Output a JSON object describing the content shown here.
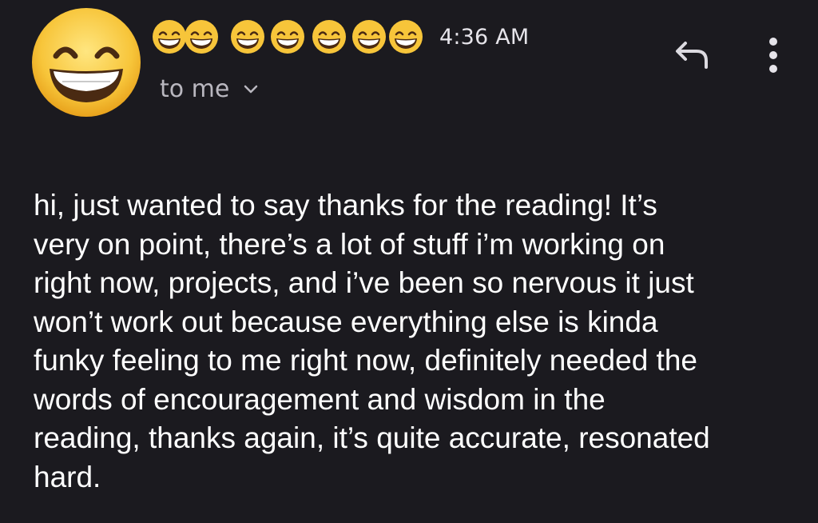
{
  "header": {
    "sender_avatar_icon": "grinning-face-with-smiling-eyes",
    "sender_name_icons": [
      "grinning-face-with-smiling-eyes",
      "grinning-face-with-smiling-eyes",
      "grinning-face-with-smiling-eyes",
      "grinning-face-with-smiling-eyes",
      "grinning-face-with-smiling-eyes",
      "grinning-face-with-smiling-eyes",
      "grinning-face-with-smiling-eyes"
    ],
    "time": "4:36 AM",
    "recipient_label": "to me",
    "recipient_icon": "chevron-down-icon",
    "reply_icon": "reply-icon",
    "more_icon": "more-vert-icon"
  },
  "message": {
    "body": "hi, just wanted to say thanks for the reading! It’s\nvery on point, there’s a lot of stuff i’m working on\nright now, projects, and i’ve been so nervous it just\nwon’t work out because everything else is kinda\nfunky feeling to me right now, definitely needed the\nwords of encouragement and wisdom in the\nreading, thanks again, it’s quite accurate, resonated\nhard."
  },
  "colors": {
    "background": "#1b1a1f",
    "text": "#ffffff",
    "secondary_text": "#b9b7bf",
    "emoji_face": "#f7c53a"
  }
}
